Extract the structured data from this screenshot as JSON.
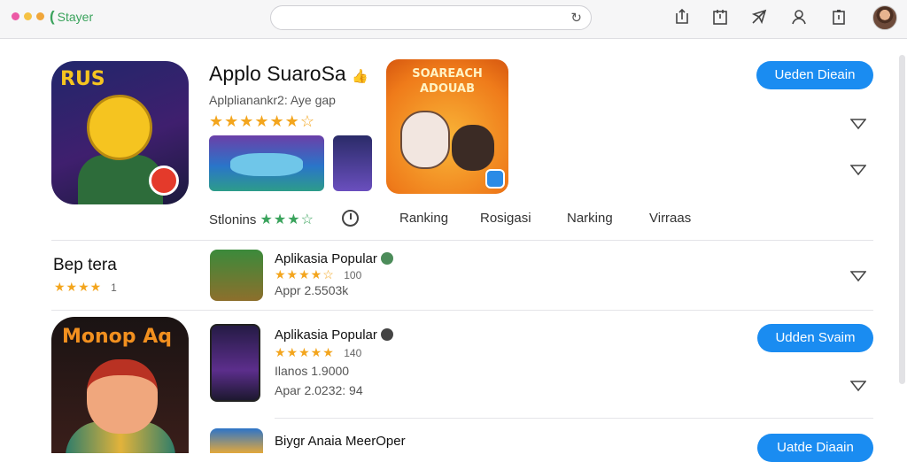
{
  "window": {
    "brand": "Stayer",
    "search_value": "",
    "reload_glyph": "↻"
  },
  "colors": {
    "accent": "#1a8cf1",
    "star": "#f3a51d",
    "green": "#3aa35c"
  },
  "toolbar_icons": [
    "share-icon",
    "calendar-icon",
    "send-icon",
    "account-icon",
    "clipboard-icon"
  ],
  "hero": {
    "icon_text": "RUS",
    "title": "Applo SuaroSa",
    "title_glyph": "👍",
    "subtitle": "Aplplianankr2: Aye gap",
    "rating_stars": "★★★★★★☆",
    "rating_value": 5.5,
    "button_label": "Ueden Dieain",
    "feature_text": "SOAREACH ADOUAB"
  },
  "stats_bar": {
    "items": [
      {
        "label": "Stlonins",
        "stars": "★★★☆"
      },
      {
        "label": "Ranking"
      },
      {
        "label": "Rosigasi"
      },
      {
        "label": "Narking"
      },
      {
        "label": "Virraas"
      }
    ]
  },
  "section": {
    "title": "Bep tera",
    "stars": "★★★★",
    "count": "1"
  },
  "rows": [
    {
      "title": "Aplikasia Popular",
      "stars": "★★★★☆",
      "rating": "100",
      "meta": "Appr 2.5503k"
    },
    {
      "title": "Aplikasia Popular",
      "stars": "★★★★★",
      "rating": "140",
      "meta1": "Ilanos 1.9000",
      "meta2": "Apar 2.0232: 94",
      "button_label": "Udden Svaim"
    },
    {
      "title": "Biygr Anaia MeerOper",
      "button_label": "Uatde Diaain"
    }
  ],
  "big_tile_text": "Monop Aq"
}
